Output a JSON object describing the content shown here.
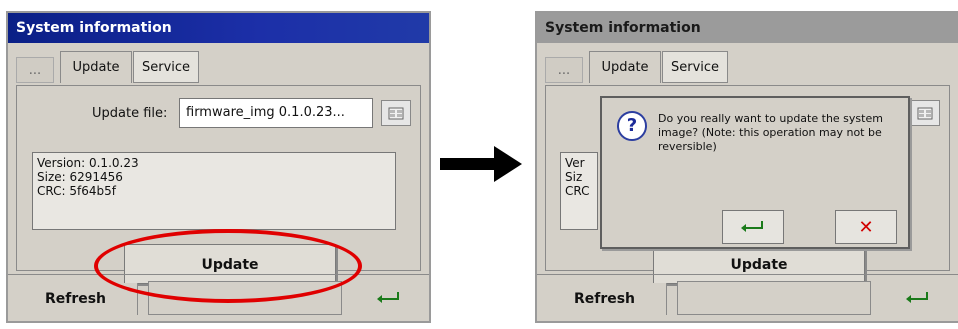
{
  "left": {
    "title": "System information",
    "tabs": {
      "dash": "...",
      "update": "Update",
      "service": "Service"
    },
    "file": {
      "label": "Update file:",
      "value": "firmware_img 0.1.0.23..."
    },
    "info": {
      "lines": [
        "Version: 0.1.0.23",
        "Size: 6291456",
        "CRC: 5f64b5f"
      ]
    },
    "buttons": {
      "update": "Update",
      "refresh": "Refresh"
    }
  },
  "right": {
    "title": "System information",
    "tabs": {
      "dash": "...",
      "update": "Update",
      "service": "Service"
    },
    "info_partial": {
      "lines": [
        "Ver",
        "Siz",
        "CRC"
      ]
    },
    "buttons": {
      "update": "Update",
      "refresh": "Refresh"
    },
    "dialog": {
      "message": "Do you really want to update the system image? (Note: this operation may not be reversible)",
      "icon": "question-icon",
      "ok_icon": "enter-icon",
      "cancel_icon": "close-icon"
    }
  },
  "annotation": {
    "highlight_color": "#e00000",
    "arrow": "right-arrow"
  },
  "colors": {
    "titlebar_active": "#0a1f86",
    "panel_bg": "#d4d0c8"
  }
}
